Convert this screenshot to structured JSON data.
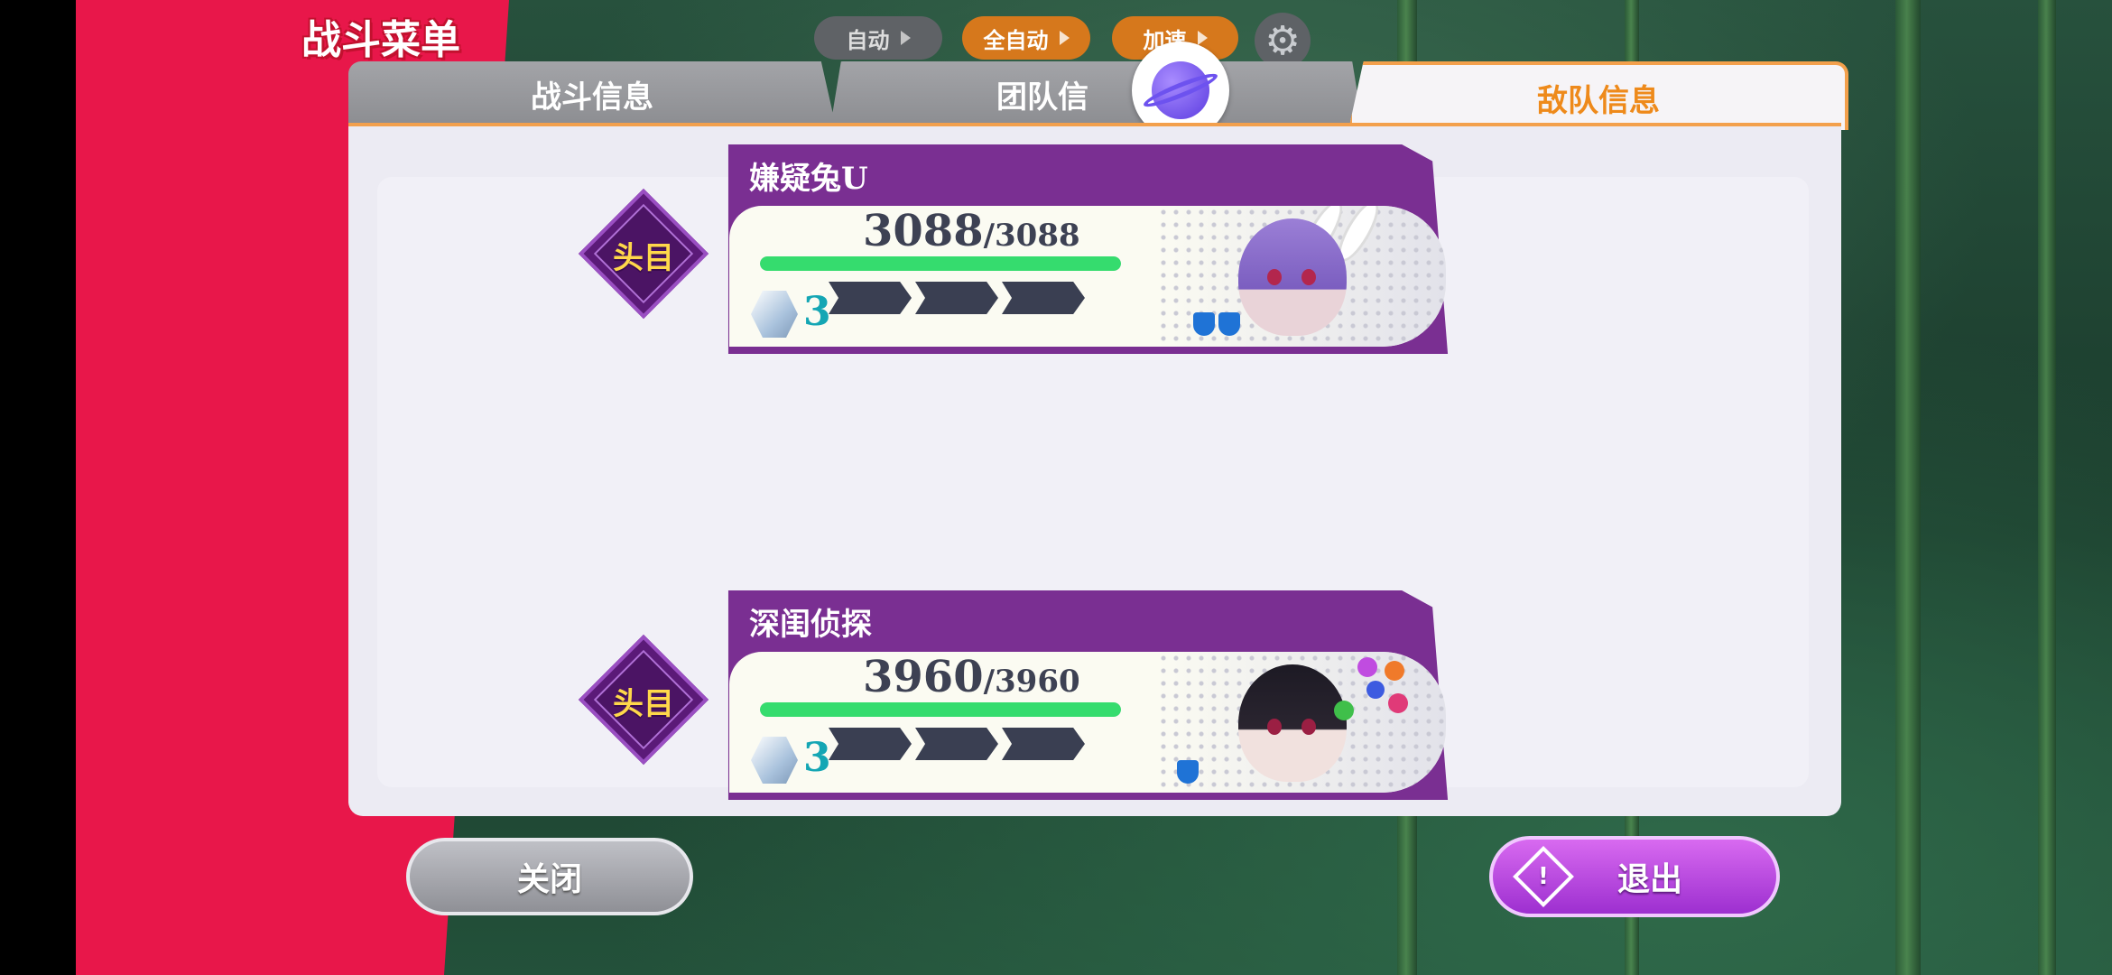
{
  "menu_title": "战斗菜单",
  "top_bar": {
    "auto_label": "自动",
    "full_auto_label": "全自动",
    "speed_label": "加速"
  },
  "tabs": [
    {
      "label": "战斗信息",
      "active": false
    },
    {
      "label": "团队信",
      "active": false
    },
    {
      "label": "敌队信息",
      "active": true
    }
  ],
  "enemies": [
    {
      "name": "嫌疑兔U",
      "hp_current": "3088",
      "hp_max": "/3088",
      "hp_fraction": 1.0,
      "gem_count": "3",
      "badge": "头目"
    },
    {
      "name": "深闺侦探",
      "hp_current": "3960",
      "hp_max": "/3960",
      "hp_fraction": 1.0,
      "gem_count": "3",
      "badge": "头目"
    }
  ],
  "buttons": {
    "close_label": "关闭",
    "exit_label": "退出"
  },
  "colors": {
    "accent_red": "#e8174a",
    "tab_active_text": "#ee8a1b",
    "card_purple": "#7a2f92",
    "hp_green": "#35dc6e",
    "exit_purple": "#b347dd"
  }
}
